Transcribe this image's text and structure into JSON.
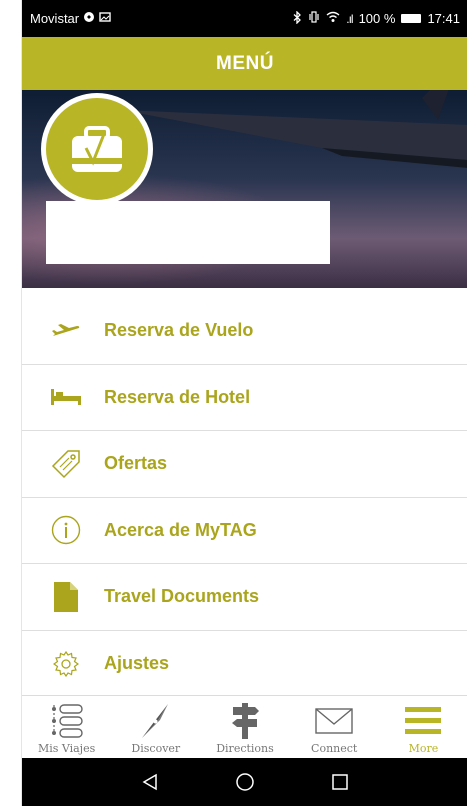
{
  "status_bar": {
    "carrier": "Movistar",
    "signal_text": ".ıl",
    "battery": "100 %",
    "time": "17:41"
  },
  "header": {
    "title": "MENÚ"
  },
  "menu": {
    "items": [
      {
        "label": "Reserva de Vuelo",
        "icon": "airplane-icon"
      },
      {
        "label": "Reserva de Hotel",
        "icon": "bed-icon"
      },
      {
        "label": "Ofertas",
        "icon": "tag-icon"
      },
      {
        "label": "Acerca de MyTAG",
        "icon": "info-icon"
      },
      {
        "label": "Travel Documents",
        "icon": "document-icon"
      },
      {
        "label": "Ajustes",
        "icon": "gear-icon"
      }
    ]
  },
  "tab_bar": {
    "tabs": [
      {
        "label": "Mis Viajes",
        "icon": "list-icon"
      },
      {
        "label": "Discover",
        "icon": "compass-icon"
      },
      {
        "label": "Directions",
        "icon": "signpost-icon"
      },
      {
        "label": "Connect",
        "icon": "envelope-icon"
      },
      {
        "label": "More",
        "icon": "hamburger-icon",
        "active": true
      }
    ]
  },
  "colors": {
    "accent": "#b8b526",
    "accent_text": "#aaa51d",
    "tab_inactive": "#777777"
  }
}
